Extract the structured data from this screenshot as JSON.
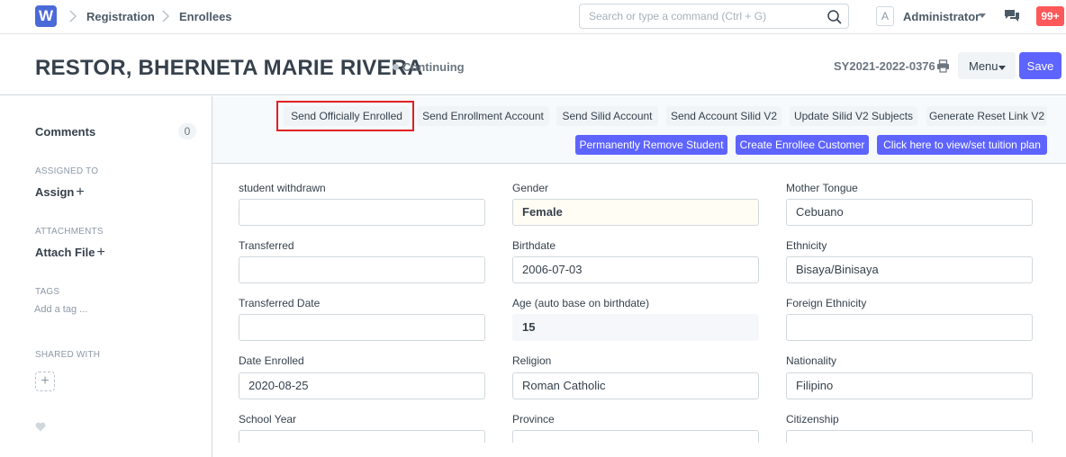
{
  "navbar": {
    "logo_letter": "W",
    "breadcrumbs": [
      "Registration",
      "Enrollees"
    ],
    "search_placeholder": "Search or type a command (Ctrl + G)",
    "avatar_letter": "A",
    "user_name": "Administrator",
    "notifications": "99+"
  },
  "header": {
    "title": "RESTOR, BHERNETA MARIE RIVERA",
    "status": "Continuing",
    "doc_id": "SY2021-2022-0376",
    "menu_label": "Menu",
    "save_label": "Save"
  },
  "sidebar": {
    "comments_label": "Comments",
    "comments_count": "0",
    "assigned_to_label": "ASSIGNED TO",
    "assign_label": "Assign",
    "attachments_label": "ATTACHMENTS",
    "attach_label": "Attach File",
    "tags_label": "TAGS",
    "add_tag": "Add a tag ...",
    "shared_with_label": "SHARED WITH",
    "plus": "+"
  },
  "actions": {
    "row1": [
      "Send Officially Enrolled",
      "Send Enrollment Account",
      "Send Silid Account",
      "Send Account Silid V2",
      "Update Silid V2 Subjects",
      "Generate Reset Link V2"
    ],
    "row2": [
      "Permanently Remove Student",
      "Create Enrollee Customer",
      "Click here to view/set tuition plan"
    ]
  },
  "form": {
    "col1": [
      {
        "label": "student withdrawn",
        "value": ""
      },
      {
        "label": "Transferred",
        "value": ""
      },
      {
        "label": "Transferred Date",
        "value": ""
      },
      {
        "label": "Date Enrolled",
        "value": "2020-08-25"
      },
      {
        "label": "School Year",
        "value": ""
      }
    ],
    "col2": [
      {
        "label": "Gender",
        "value": "Female"
      },
      {
        "label": "Birthdate",
        "value": "2006-07-03"
      },
      {
        "label": "Age (auto base on birthdate)",
        "value": "15"
      },
      {
        "label": "Religion",
        "value": "Roman Catholic"
      },
      {
        "label": "Province",
        "value": ""
      }
    ],
    "col3": [
      {
        "label": "Mother Tongue",
        "value": "Cebuano"
      },
      {
        "label": "Ethnicity",
        "value": "Bisaya/Binisaya"
      },
      {
        "label": "Foreign Ethnicity",
        "value": ""
      },
      {
        "label": "Nationality",
        "value": "Filipino"
      },
      {
        "label": "Citizenship",
        "value": ""
      }
    ]
  },
  "colors": {
    "primary": "#5e64ff",
    "logo": "#4a6ad8",
    "badge": "#ff5858",
    "highlight": "#e02020"
  }
}
